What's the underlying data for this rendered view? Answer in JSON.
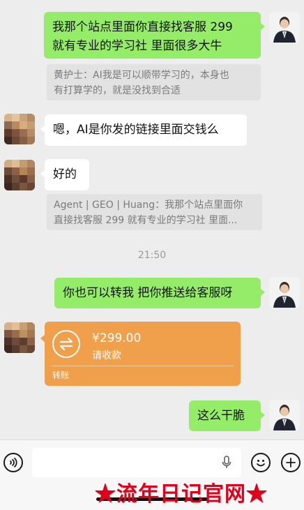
{
  "messages": {
    "m1_line1": "我那个站点里面你直接找客服 299",
    "m1_line2": "就有专业的学习社 里面很多大牛",
    "q1_line1": "黄护士：AI我是可以顺带学习的，本身也",
    "q1_line2": "有打算学的，就是没找到合适",
    "m2": "嗯，AI是你发的链接里面交钱么",
    "m3": "好的",
    "q2_line1": "Agent | GEO | Huang：我那个站点里面你",
    "q2_line2": "直接找客服 299 就有专业的学习社 里面...",
    "timestamp": "21:50",
    "m4": "你也可以转我 把你推送给客服呀",
    "m6": "这么干脆"
  },
  "transfer": {
    "amount": "¥299.00",
    "note": "请收款",
    "type": "转账"
  },
  "watermark": "★流年日记官网★",
  "icons": {
    "voice": "voice-icon",
    "mic": "mic-icon",
    "emoji": "emoji-icon",
    "plus": "plus-icon",
    "transfer": "transfer-icon"
  },
  "colors": {
    "self_bubble": "#95ec69",
    "peer_bubble": "#ffffff",
    "transfer_card": "#f0a04b",
    "watermark": "#e0001b",
    "background": "#ededed"
  }
}
